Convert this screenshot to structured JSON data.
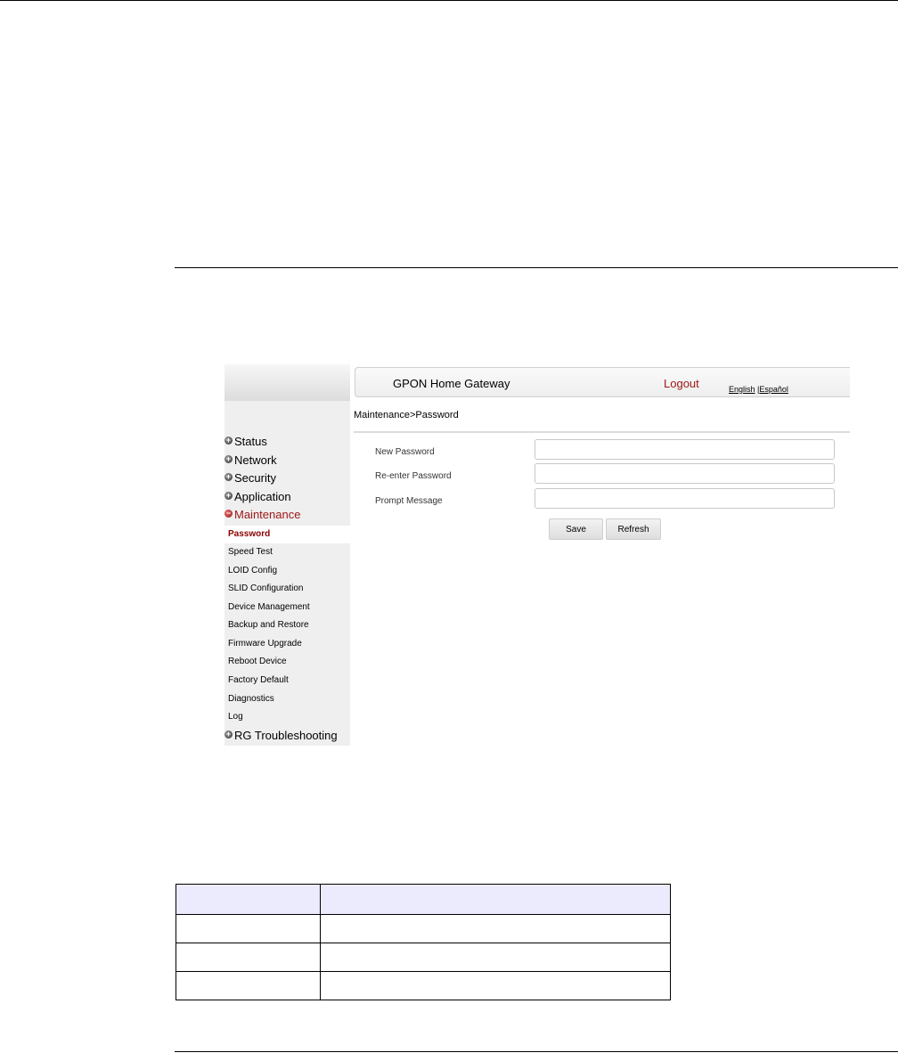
{
  "header": {
    "title": "GPON Home Gateway",
    "logout": "Logout",
    "lang_english": "English",
    "lang_sep": "|",
    "lang_spanish": "Español"
  },
  "breadcrumb": "Maintenance>Password",
  "sidebar": {
    "top_items": [
      {
        "label": "Status",
        "icon": "plus-icon"
      },
      {
        "label": "Network",
        "icon": "plus-icon"
      },
      {
        "label": "Security",
        "icon": "plus-icon"
      },
      {
        "label": "Application",
        "icon": "plus-icon"
      },
      {
        "label": "Maintenance",
        "icon": "minus-icon",
        "active": true
      }
    ],
    "sub_items": [
      "Password",
      "Speed Test",
      "LOID Config",
      "SLID Configuration",
      "Device Management",
      "Backup and Restore",
      "Firmware Upgrade",
      "Reboot Device",
      "Factory Default",
      "Diagnostics",
      "Log"
    ],
    "selected_sub": "Password",
    "last_item": {
      "label": "RG Troubleshooting",
      "icon": "plus-icon"
    }
  },
  "form": {
    "fields": [
      {
        "label": "New Password",
        "value": ""
      },
      {
        "label": "Re-enter Password",
        "value": ""
      },
      {
        "label": "Prompt Message",
        "value": ""
      }
    ],
    "save_label": "Save",
    "refresh_label": "Refresh"
  },
  "colors": {
    "accent": "#a01818",
    "sidebar_bg": "#efefef",
    "table_header_bg": "#ebebfd"
  }
}
